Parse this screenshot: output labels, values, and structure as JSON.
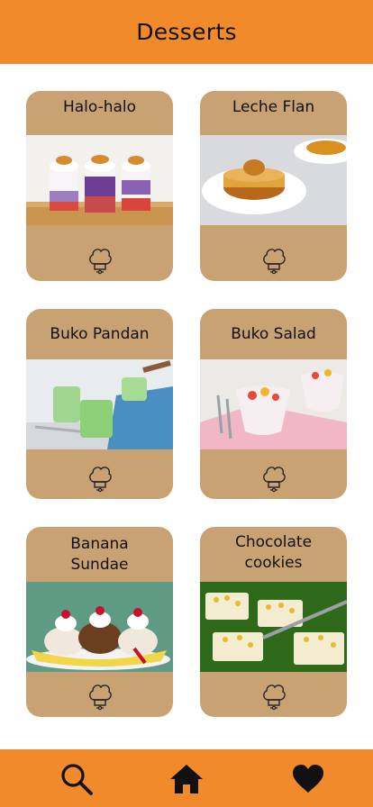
{
  "header": {
    "title": "Desserts"
  },
  "cards": [
    {
      "lines": [
        "Halo-halo"
      ]
    },
    {
      "lines": [
        "Leche Flan"
      ]
    },
    {
      "lines": [
        "Buko Pandan"
      ]
    },
    {
      "lines": [
        "Buko Salad"
      ]
    },
    {
      "lines": [
        "Banana",
        "Sundae"
      ]
    },
    {
      "lines": [
        "Chocolate",
        "cookies"
      ]
    }
  ],
  "nav": {
    "items": [
      {
        "icon": "search-icon"
      },
      {
        "icon": "home-icon"
      },
      {
        "icon": "heart-icon"
      }
    ]
  },
  "colors": {
    "accent": "#f08a2b",
    "card": "#c8a272"
  }
}
